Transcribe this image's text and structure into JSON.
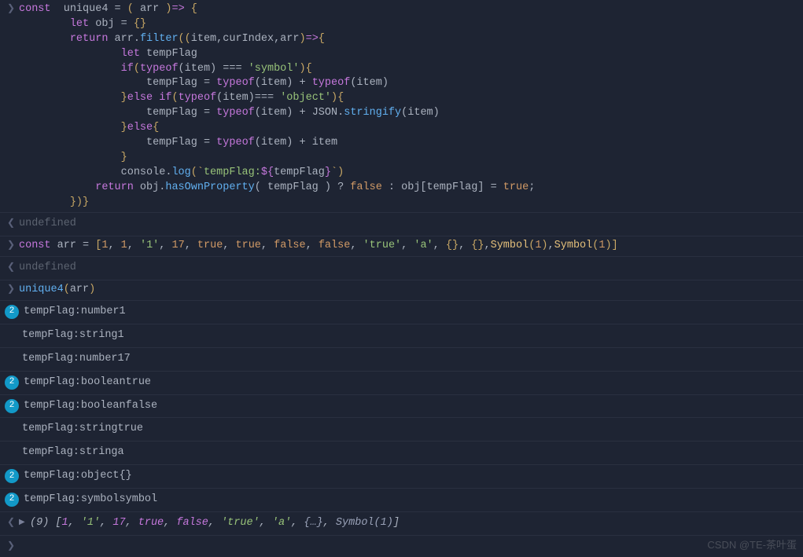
{
  "code": {
    "line1_a": "const",
    "line1_b": "  unique4 ",
    "line1_c": "=",
    "line1_d": " ( ",
    "line1_e": "arr",
    "line1_f": " )",
    "line1_g": "=>",
    "line1_h": " {",
    "l2_a": "let",
    "l2_b": " obj ",
    "l2_c": "=",
    "l2_d": " {}",
    "l3_a": "return",
    "l3_b": " arr.",
    "l3_c": "filter",
    "l3_d": "((",
    "l3_e": "item,curIndex,arr",
    "l3_f": ")",
    "l3_g": "=>",
    "l3_h": "{",
    "l4_a": "let",
    "l4_b": " tempFlag",
    "l5_a": "if",
    "l5_b": "(",
    "l5_c": "typeof",
    "l5_d": "(item) ",
    "l5_e": "===",
    "l5_f": " 'symbol'",
    "l5_g": "){",
    "l6_a": "tempFlag ",
    "l6_b": "=",
    "l6_c": " typeof",
    "l6_d": "(item) ",
    "l6_e": "+",
    "l6_f": " typeof",
    "l6_g": "(item)",
    "l7_a": "}",
    "l7_b": "else if",
    "l7_c": "(",
    "l7_d": "typeof",
    "l7_e": "(item)",
    "l7_f": "===",
    "l7_g": " 'object'",
    "l7_h": "){",
    "l8_a": "tempFlag ",
    "l8_b": "=",
    "l8_c": " typeof",
    "l8_d": "(item) ",
    "l8_e": "+",
    "l8_f": " JSON.",
    "l8_g": "stringify",
    "l8_h": "(item)",
    "l9_a": "}",
    "l9_b": "else",
    "l9_c": "{",
    "l10_a": "tempFlag ",
    "l10_b": "=",
    "l10_c": " typeof",
    "l10_d": "(item) ",
    "l10_e": "+",
    "l10_f": " item",
    "l11": "}",
    "l12_a": "console.",
    "l12_b": "log",
    "l12_c": "(`",
    "l12_d": "tempFlag:",
    "l12_e": "${",
    "l12_f": "tempFlag",
    "l12_g": "}",
    "l12_h": "`)",
    "l13_a": "return",
    "l13_b": " obj.",
    "l13_c": "hasOwnProperty",
    "l13_d": "( tempFlag ) ",
    "l13_e": "?",
    "l13_f": " false ",
    "l13_g": ":",
    "l13_h": " obj[tempFlag] ",
    "l13_i": "=",
    "l13_j": " true",
    ";": ";",
    "l14": "})}"
  },
  "out1": "undefined",
  "input2_a": "const",
  "input2_b": " arr ",
  "input2_c": "=",
  "input2_d": " [",
  "input2_e": "1, 1, '1', 17, true, true, false, false, 'true', 'a', {}, {},Symbol(1),Symbol(1)",
  "input2_f": "]",
  "arrTokens": [
    "1",
    ", ",
    "1",
    ", ",
    "'1'",
    ", ",
    "17",
    ", ",
    "true",
    ", ",
    "true",
    ", ",
    "false",
    ", ",
    "false",
    ", ",
    "'true'",
    ", ",
    "'a'",
    ", ",
    "{}",
    ", ",
    "{}",
    ",",
    "Symbol",
    "(",
    "1",
    ")",
    ",",
    "Symbol",
    "(",
    "1",
    ")"
  ],
  "out2": "undefined",
  "input3": "unique4(arr)",
  "logs": [
    {
      "count": "2",
      "text": "tempFlag:number1"
    },
    {
      "count": "",
      "text": "tempFlag:string1"
    },
    {
      "count": "",
      "text": "tempFlag:number17"
    },
    {
      "count": "2",
      "text": "tempFlag:booleantrue"
    },
    {
      "count": "2",
      "text": "tempFlag:booleanfalse"
    },
    {
      "count": "",
      "text": "tempFlag:stringtrue"
    },
    {
      "count": "",
      "text": "tempFlag:stringa"
    },
    {
      "count": "2",
      "text": "tempFlag:object{}"
    },
    {
      "count": "2",
      "text": "tempFlag:symbolsymbol"
    }
  ],
  "result_count": "(9) ",
  "resultTokens": [
    "[",
    "1",
    ", ",
    "'1'",
    ", ",
    "17",
    ", ",
    "true",
    ", ",
    "false",
    ", ",
    "'true'",
    ", ",
    "'a'",
    ", ",
    "{…}",
    ", ",
    "Symbol(1)",
    "]"
  ],
  "watermark": "CSDN @TE-茶叶蛋"
}
